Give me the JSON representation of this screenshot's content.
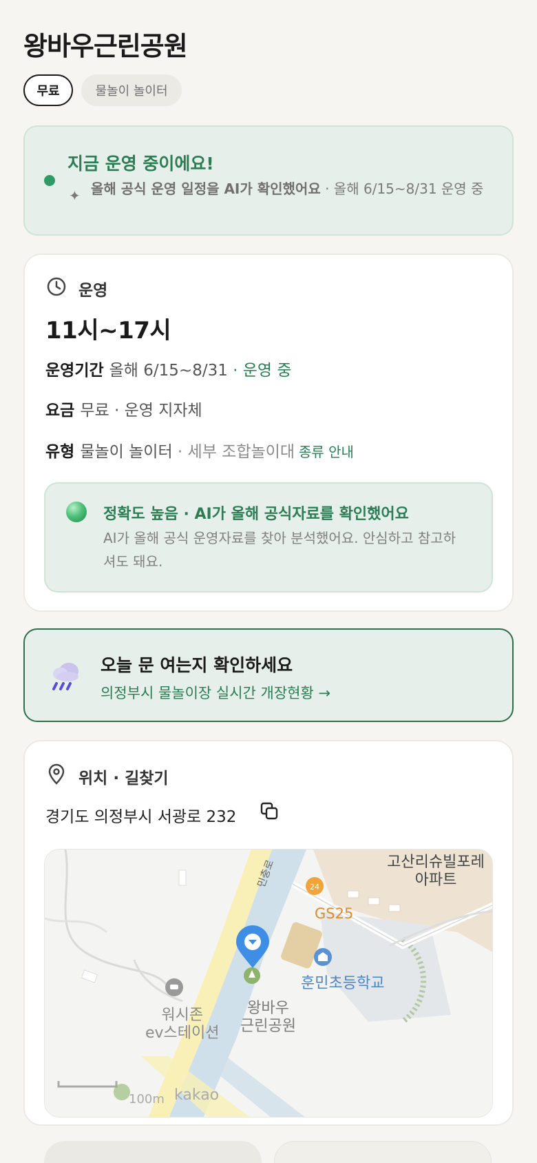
{
  "place": {
    "title": "왕바우근린공원",
    "chips": [
      "무료",
      "물놀이 놀이터"
    ]
  },
  "status": {
    "title": "지금 운영 중이에요!",
    "desc_strong": "올해 공식 운영 일정을 AI가 확인했어요",
    "desc_rest": " · 올해 6/15~8/31 운영 중"
  },
  "operation": {
    "section_title": "운영",
    "hours": "11시~17시",
    "period_key": "운영기간",
    "period_value": "올해 6/15~8/31",
    "period_status": " · 운영 중",
    "fee_key": "요금",
    "fee_value": "무료 · 운영 지자체",
    "type_key": "유형",
    "type_value": "물놀이 놀이터",
    "type_detail": " · 세부 조합놀이대",
    "type_link": "종류 안내",
    "accuracy_title": "정확도 높음 · AI가 올해 공식자료를 확인했어요",
    "accuracy_desc": "AI가 올해 공식 운영자료를 찾아 분석했어요. 안심하고 참고하셔도 돼요."
  },
  "check": {
    "title": "오늘 문 여는지 확인하세요",
    "link": "의정부시 물놀이장 실시간 개장현황 →"
  },
  "location": {
    "section_title": "위치 · 길찾기",
    "address": "경기도 의정부시 서광로 232",
    "map": {
      "apartment": "고산리슈빌포레\n아파트",
      "gs": "GS25",
      "school": "훈민초등학교",
      "park": "왕바우\n근린공원",
      "ev": "워시존\nev스테이션",
      "road": "민충로",
      "scale": "100m",
      "brand": "kakao"
    }
  },
  "colors": {
    "accent_green": "#2a7d55",
    "status_bg": "#e6efe9",
    "border_green": "#2d6e4d"
  }
}
